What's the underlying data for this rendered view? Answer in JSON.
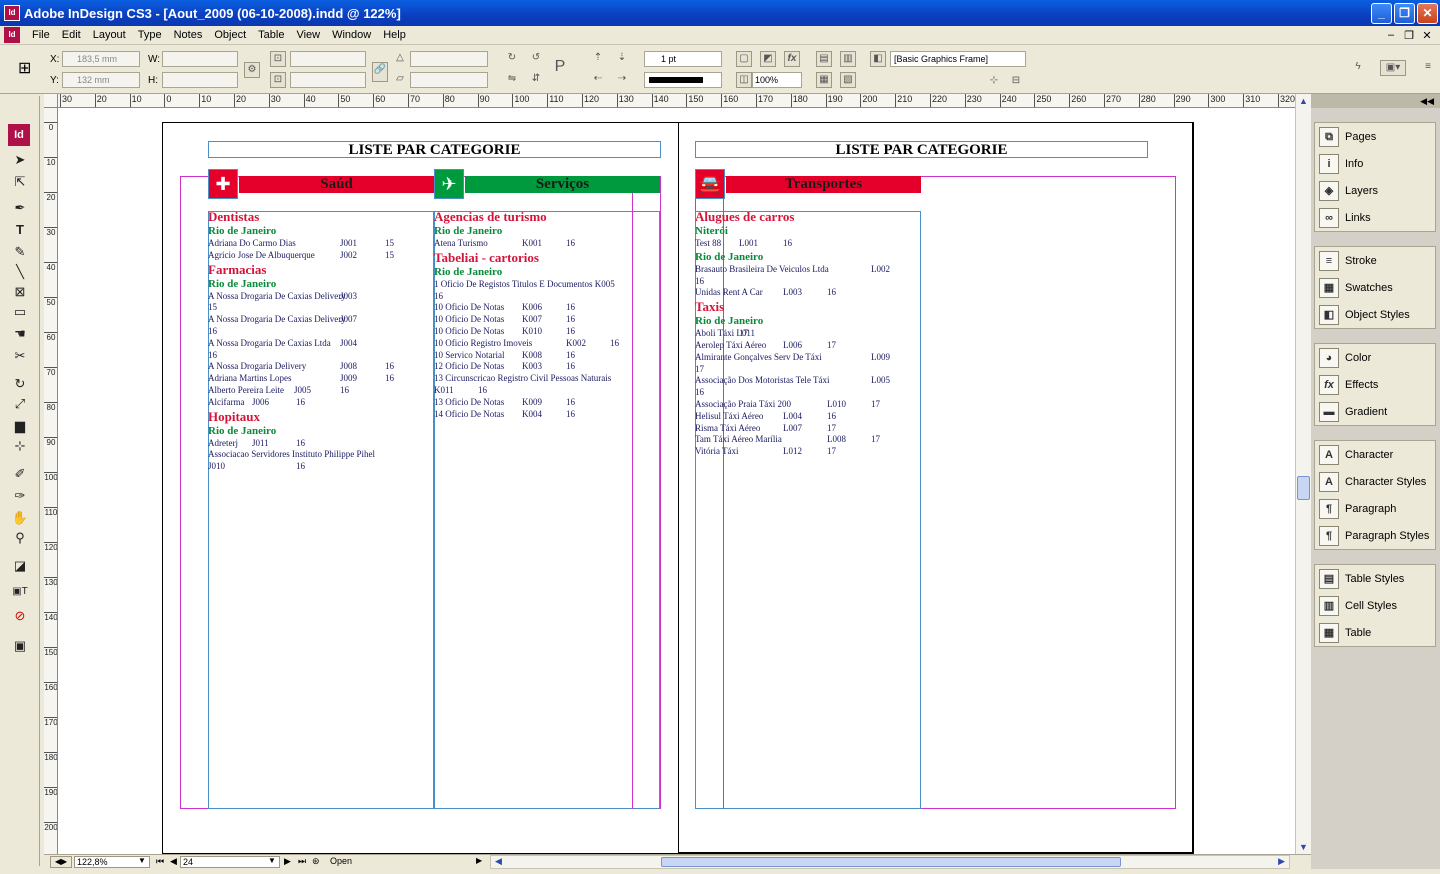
{
  "window": {
    "title": "Adobe InDesign CS3 - [Aout_2009 (06-10-2008).indd @ 122%]",
    "app_icon": "Id"
  },
  "menu": [
    "File",
    "Edit",
    "Layout",
    "Type",
    "Notes",
    "Object",
    "Table",
    "View",
    "Window",
    "Help"
  ],
  "control": {
    "x": "183,5 mm",
    "y": "132 mm",
    "w_label": "W:",
    "h_label": "H:",
    "x_label": "X:",
    "y_label": "Y:",
    "stroke_weight": "1 pt",
    "opacity": "100%",
    "object_style": "[Basic Graphics Frame]"
  },
  "ruler": {
    "h_ticks": [
      "30",
      "20",
      "10",
      "0",
      "10",
      "20",
      "30",
      "40",
      "50",
      "60",
      "70",
      "80",
      "90",
      "100",
      "110",
      "120",
      "130",
      "140",
      "150",
      "160",
      "170",
      "180",
      "190",
      "200",
      "210",
      "220",
      "230",
      "240",
      "250",
      "260",
      "270",
      "280",
      "290",
      "300",
      "310",
      "320"
    ],
    "v_ticks": [
      "0",
      "10",
      "20",
      "30",
      "40",
      "50",
      "60",
      "70",
      "80",
      "90",
      "100",
      "110",
      "120",
      "130",
      "140",
      "150",
      "160",
      "170",
      "180",
      "190",
      "200"
    ]
  },
  "page_left": {
    "title": "LISTE PAR CATEGORIE",
    "cat1": "Saúd",
    "cat2": "Serviços",
    "col1": [
      {
        "t": "h1",
        "text": "Dentistas"
      },
      {
        "t": "h2",
        "text": "Rio de Janeiro"
      },
      {
        "t": "row",
        "name": "Adriana Do Carmo Dias",
        "code": "J001",
        "num": "15"
      },
      {
        "t": "row",
        "name": "Agricio Jose De Albuquerque",
        "code": "J002",
        "num": "15"
      },
      {
        "t": "h1",
        "text": "Farmacias"
      },
      {
        "t": "h2",
        "text": "Rio de Janeiro"
      },
      {
        "t": "row",
        "name": "A Nossa Drogaria De Caxias Delivery",
        "code": "J003",
        "num": ""
      },
      {
        "t": "wrap",
        "text": "15"
      },
      {
        "t": "row",
        "name": "A Nossa Drogaria De Caxias Delivery",
        "code": "J007",
        "num": ""
      },
      {
        "t": "wrap",
        "text": "16"
      },
      {
        "t": "row",
        "name": "A Nossa Drogaria De Caxias Ltda",
        "code": "J004",
        "num": ""
      },
      {
        "t": "wrap",
        "text": "16"
      },
      {
        "t": "row",
        "name": "A Nossa Drogaria Delivery",
        "code": "J008",
        "num": "16"
      },
      {
        "t": "row",
        "name": "Adriana Martins Lopes",
        "code": "J009",
        "num": "16"
      },
      {
        "t": "row2",
        "name": "Alberto Pereira Leite",
        "code": "J005",
        "num": "16"
      },
      {
        "t": "row3",
        "name": "Alcifarma",
        "code": "J006",
        "num": "16"
      },
      {
        "t": "h1",
        "text": "Hopitaux"
      },
      {
        "t": "h2",
        "text": "Rio de Janeiro"
      },
      {
        "t": "row3",
        "name": "Adreterj",
        "code": "J011",
        "num": "16"
      },
      {
        "t": "wrap",
        "text": "Associacao Servidores Instituto Philippe Pihel"
      },
      {
        "t": "row3",
        "name": "J010",
        "code": "",
        "num": "16"
      }
    ],
    "col2": [
      {
        "t": "h1",
        "text": "Agencias de turismo"
      },
      {
        "t": "h2",
        "text": "Rio de Janeiro"
      },
      {
        "t": "row",
        "name": "Atena Turismo",
        "code": "K001",
        "num": "16"
      },
      {
        "t": "h1",
        "text": "Tabeliai - cartorios"
      },
      {
        "t": "h2",
        "text": "Rio de Janeiro"
      },
      {
        "t": "wrap",
        "text": "1 Oficio De Registos Titulos E Documentos  K005"
      },
      {
        "t": "wrap",
        "text": "16"
      },
      {
        "t": "row",
        "name": "10 Oficio De Notas",
        "code": "K006",
        "num": "16"
      },
      {
        "t": "row",
        "name": "10 Oficio De Notas",
        "code": "K007",
        "num": "16"
      },
      {
        "t": "row",
        "name": "10 Oficio De Notas",
        "code": "K010",
        "num": "16"
      },
      {
        "t": "rowk",
        "name": "10 Oficio Registro Imoveis",
        "code": "K002",
        "num": "16"
      },
      {
        "t": "row",
        "name": "10 Servico Notarial",
        "code": "K008",
        "num": "16"
      },
      {
        "t": "row",
        "name": "12 Oficio De Notas",
        "code": "K003",
        "num": "16"
      },
      {
        "t": "wrap",
        "text": "13 Circunscricao Registro Civil Pessoas Naturais"
      },
      {
        "t": "row3",
        "name": "K011",
        "code": "16",
        "num": ""
      },
      {
        "t": "row",
        "name": "13 Oficio De Notas",
        "code": "K009",
        "num": "16"
      },
      {
        "t": "row",
        "name": "14 Oficio De Notas",
        "code": "K004",
        "num": "16"
      }
    ]
  },
  "page_right": {
    "title": "LISTE PAR CATEGORIE",
    "cat1": "Transportes",
    "col1": [
      {
        "t": "h1",
        "text": "Alugues de carros"
      },
      {
        "t": "h2",
        "text": "Niterói"
      },
      {
        "t": "row3",
        "name": "Test 88",
        "code": "L001",
        "num": "16"
      },
      {
        "t": "h2",
        "text": "Rio de Janeiro"
      },
      {
        "t": "rowL",
        "name": "Brasauto Brasileira De Veiculos Ltda",
        "code": "L002",
        "num": ""
      },
      {
        "t": "wrap",
        "text": "16"
      },
      {
        "t": "row2",
        "name": "Unidas Rent A Car",
        "code": "L003",
        "num": "16"
      },
      {
        "t": "h1",
        "text": "Taxis"
      },
      {
        "t": "h2",
        "text": "Rio de Janeiro"
      },
      {
        "t": "row3",
        "name": "Aboli Táxi L011",
        "code": "17",
        "num": ""
      },
      {
        "t": "row2",
        "name": "Aerolep Táxi Aéreo",
        "code": "L006",
        "num": "17"
      },
      {
        "t": "rowL",
        "name": "Almirante Gonçalves Serv De Táxi",
        "code": "L009",
        "num": ""
      },
      {
        "t": "wrap",
        "text": "17"
      },
      {
        "t": "rowL",
        "name": "Associação Dos Motoristas Tele Táxi",
        "code": "L005",
        "num": ""
      },
      {
        "t": "wrap",
        "text": "16"
      },
      {
        "t": "rowM",
        "name": "Associação Praia Táxi 200",
        "code": "L010",
        "num": "17"
      },
      {
        "t": "row2",
        "name": "Helisul Táxi Aéreo",
        "code": "L004",
        "num": "16"
      },
      {
        "t": "row2",
        "name": "Risma Táxi Aéreo",
        "code": "L007",
        "num": "17"
      },
      {
        "t": "rowM",
        "name": "Tam Táxi Aéreo Marília",
        "code": "L008",
        "num": "17"
      },
      {
        "t": "row2",
        "name": "Vitória Táxi",
        "code": "L012",
        "num": "17"
      }
    ]
  },
  "statusbar": {
    "zoom": "122,8%",
    "page": "24",
    "status": "Open"
  },
  "panels": [
    [
      "Pages",
      "Info",
      "Layers",
      "Links"
    ],
    [
      "Stroke",
      "Swatches",
      "Object Styles"
    ],
    [
      "Color",
      "Effects",
      "Gradient"
    ],
    [
      "Character",
      "Character Styles",
      "Paragraph",
      "Paragraph Styles"
    ],
    [
      "Table Styles",
      "Cell Styles",
      "Table"
    ]
  ],
  "colors": {
    "accent_red": "#e4002b",
    "accent_green": "#009a3e",
    "frame_blue": "#4a90c8",
    "margin_magenta": "#cc33cc"
  }
}
